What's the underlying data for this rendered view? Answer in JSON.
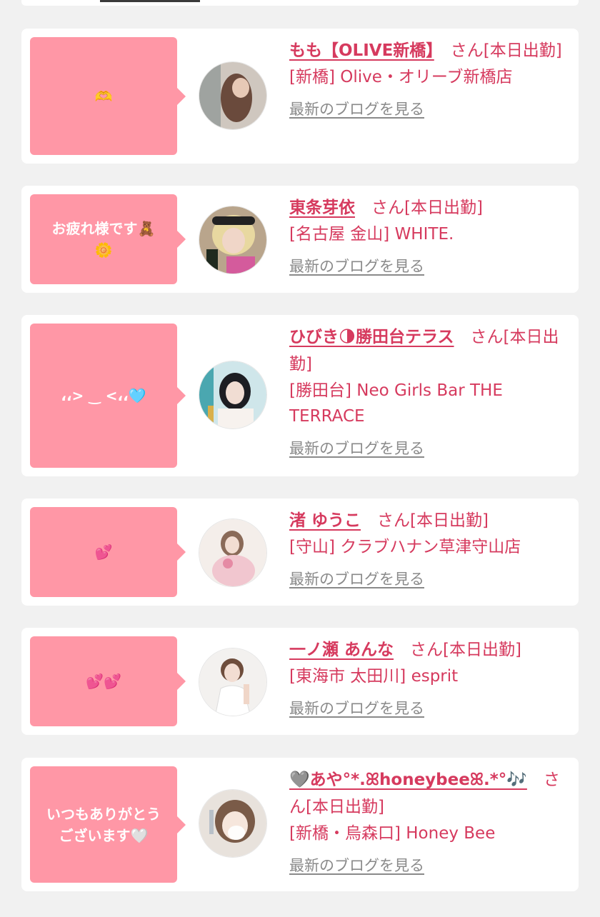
{
  "colors": {
    "accent": "#d63a5e",
    "bubble": "#ff97a6",
    "link_gray": "#8a8a8a",
    "background": "#f1f1f1",
    "card": "#ffffff"
  },
  "entries": [
    {
      "message": "🫶",
      "name": "もも【OLIVE新橋】",
      "suffix": "　さん[本日出勤]",
      "shop": "[新橋] Olive・オリーブ新橋店",
      "blog_link": "最新のブログを見る",
      "avatar_icon": "avatar-photo"
    },
    {
      "message": "お疲れ様です🧸\n🌼",
      "name": "東条芽依",
      "suffix": "　さん[本日出勤]",
      "shop": "[名古屋 金山] WHITE.",
      "blog_link": "最新のブログを見る",
      "avatar_icon": "avatar-photo"
    },
    {
      "message": "،،> ‿ <،،🩵",
      "name": "ひびき🌗勝田台テラス",
      "suffix": "　さん[本日出勤]",
      "shop": "[勝田台] Neo Girls Bar THE TERRACE",
      "blog_link": "最新のブログを見る",
      "avatar_icon": "avatar-photo"
    },
    {
      "message": "💕",
      "name": "渚 ゆうこ",
      "suffix": "　さん[本日出勤]",
      "shop": "[守山] クラブハナン草津守山店",
      "blog_link": "最新のブログを見る",
      "avatar_icon": "avatar-photo"
    },
    {
      "message": "💕💕",
      "name": "一ノ瀬 あんな",
      "suffix": "　さん[本日出勤]",
      "shop": "[東海市 太田川] esprit",
      "blog_link": "最新のブログを見る",
      "avatar_icon": "avatar-photo"
    },
    {
      "message": "いつもありがとう\nございます🤍",
      "name": "🩶あや°*.ꕤhoneybeeꕤ.*°🎶",
      "suffix": "　さん[本日出勤]",
      "shop": "[新橋・烏森口] Honey Bee",
      "blog_link": "最新のブログを見る",
      "avatar_icon": "avatar-photo"
    }
  ]
}
